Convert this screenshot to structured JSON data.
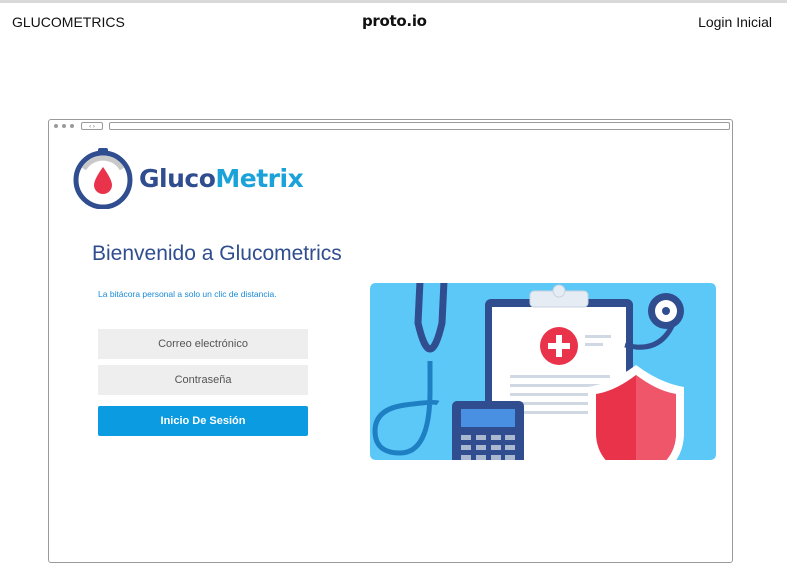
{
  "header": {
    "app_name": "GLUCOMETRICS",
    "brand": "proto.io",
    "login_link": "Login Inicial"
  },
  "logo": {
    "text_part1": "Gluco",
    "text_part2": "Metrix"
  },
  "main": {
    "title": "Bienvenido a Glucometrics",
    "subtitle": "La bitácora personal a solo un clic de distancia."
  },
  "form": {
    "email_placeholder": "Correo electrónico",
    "password_placeholder": "Contraseña",
    "submit_label": "Inicio De Sesión"
  },
  "icons": [
    "glucometer-logo-icon",
    "medical-illustration",
    "stethoscope-icon",
    "clipboard-icon",
    "shield-icon",
    "calculator-icon",
    "medical-cross-icon"
  ],
  "colors": {
    "primary_blue": "#2f4d8f",
    "accent_blue": "#1ba2d8",
    "button": "#0a9be0",
    "illustration_bg": "#5bc8f7",
    "red": "#e8334a"
  }
}
